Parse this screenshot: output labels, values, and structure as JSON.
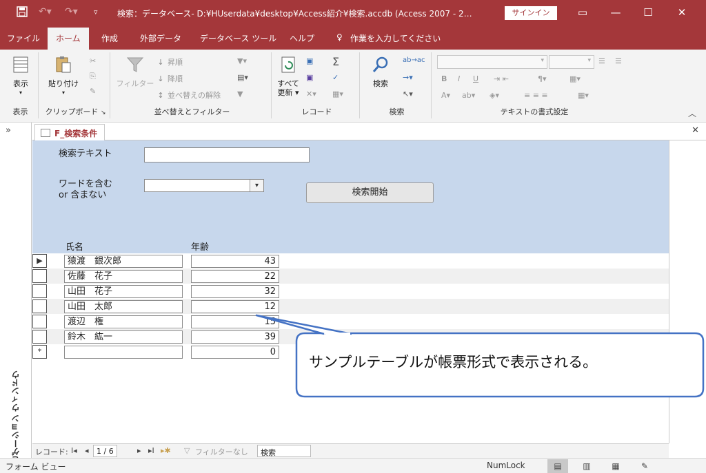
{
  "titlebar": {
    "title": "検索：データベース- D:¥HUserdata¥desktop¥Access紹介¥検索.accdb (Access 2007 - 2…",
    "signin": "サインイン",
    "icons": [
      "save-icon",
      "undo-icon",
      "redo-icon",
      "customize-icon"
    ]
  },
  "ribbon_tabs": [
    "ファイル",
    "ホーム",
    "作成",
    "外部データ",
    "データベース ツール",
    "ヘルプ",
    "作業を入力してください"
  ],
  "ribbon": {
    "view": {
      "label": "表示",
      "group": "表示"
    },
    "clipboard": {
      "paste": "貼り付け",
      "group": "クリップボード"
    },
    "sort": {
      "filter": "フィルター",
      "asc": "昇順",
      "desc": "降順",
      "clear": "並べ替えの解除",
      "group": "並べ替えとフィルター"
    },
    "records": {
      "refresh_line1": "すべて",
      "refresh_line2": "更新",
      "group": "レコード"
    },
    "find": {
      "find": "検索",
      "group": "検索"
    },
    "text": {
      "bold": "B",
      "italic": "I",
      "underline": "U",
      "group": "テキストの書式設定"
    }
  },
  "nav_pane": {
    "label": "ナビゲーション ウィンドウ",
    "chevron": "»"
  },
  "doc_tab": {
    "label": "F_検索条件"
  },
  "form": {
    "search_text_label": "検索テキスト",
    "search_text_value": "",
    "word_mode_label_1": "ワードを含む",
    "word_mode_label_2": "or 含まない",
    "word_mode_value": "",
    "search_button": "検索開始",
    "col_name": "氏名",
    "col_age": "年齢"
  },
  "records": [
    {
      "name": "猿渡　銀次郎",
      "age": "43"
    },
    {
      "name": "佐藤　花子",
      "age": "22"
    },
    {
      "name": "山田　花子",
      "age": "32"
    },
    {
      "name": "山田　太郎",
      "age": "12"
    },
    {
      "name": "渡辺　権",
      "age": "15"
    },
    {
      "name": "鈴木　紘一",
      "age": "39"
    }
  ],
  "new_record": {
    "name": "",
    "age": "0",
    "marker": "*"
  },
  "record_nav": {
    "label": "レコード:",
    "position": "1 / 6",
    "filter": "フィルターなし",
    "search": "検索"
  },
  "status": {
    "left": "フォーム ビュー",
    "numlock": "NumLock"
  },
  "callout": {
    "text": "サンプルテーブルが帳票形式で表示される。"
  }
}
